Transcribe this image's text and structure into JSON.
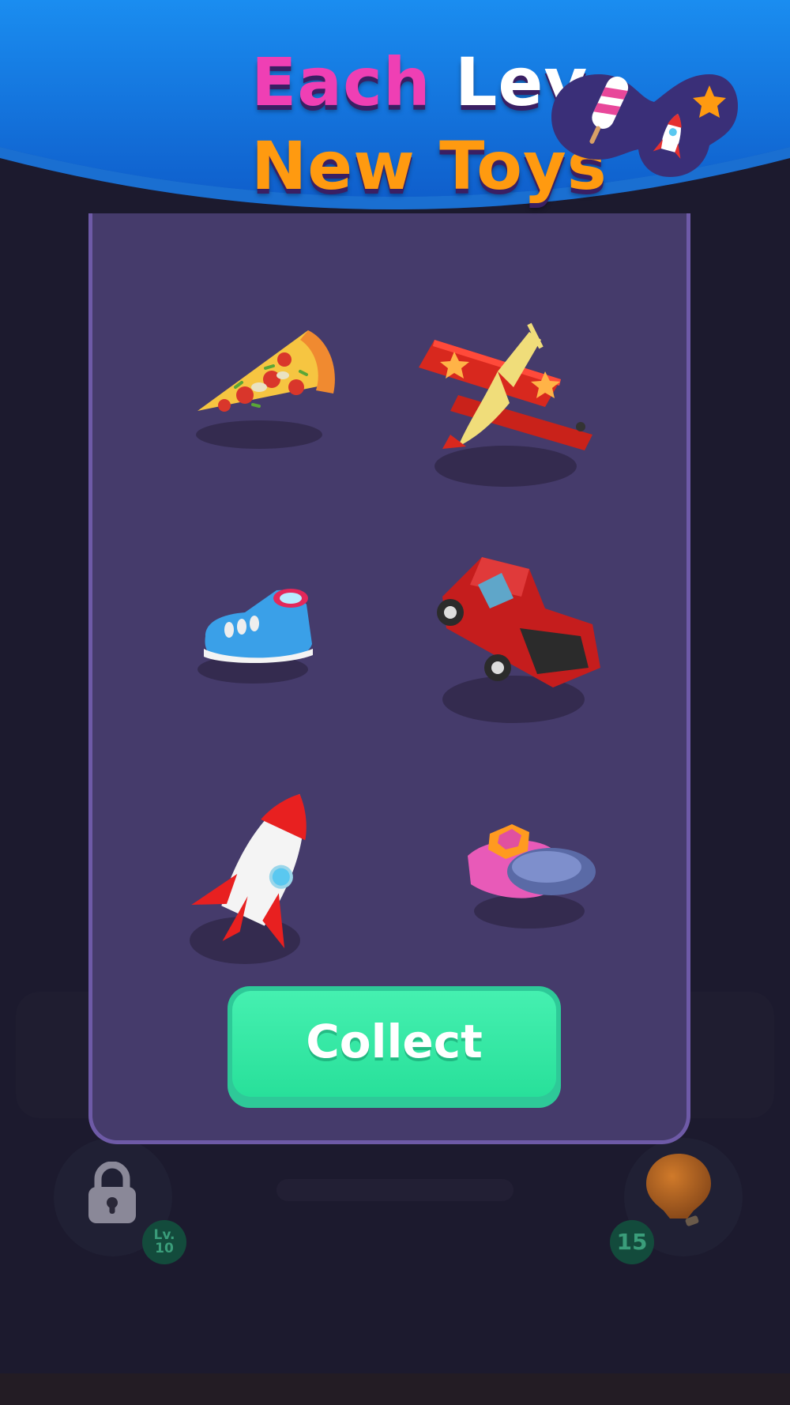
{
  "header": {
    "title_part1": "Each ",
    "title_part2": "Lev.",
    "title_line2": "New Toys"
  },
  "toys": [
    {
      "icon": "pizza-icon"
    },
    {
      "icon": "airplane-icon"
    },
    {
      "icon": "sneaker-icon"
    },
    {
      "icon": "truck-icon"
    },
    {
      "icon": "rocket-icon"
    },
    {
      "icon": "ufo-icon"
    }
  ],
  "collect": {
    "label": "Collect"
  },
  "locked_slot": {
    "icon": "lock-icon",
    "level_prefix": "Lv.",
    "level_number": "10"
  },
  "hint_slot": {
    "icon": "lightbulb-icon",
    "count": "15"
  },
  "colors": {
    "accent_pink": "#ef3fb4",
    "accent_orange": "#ff9a10",
    "button_green": "#2ec998",
    "panel_purple": "#453b6b",
    "header_blue": "#1673d9"
  }
}
